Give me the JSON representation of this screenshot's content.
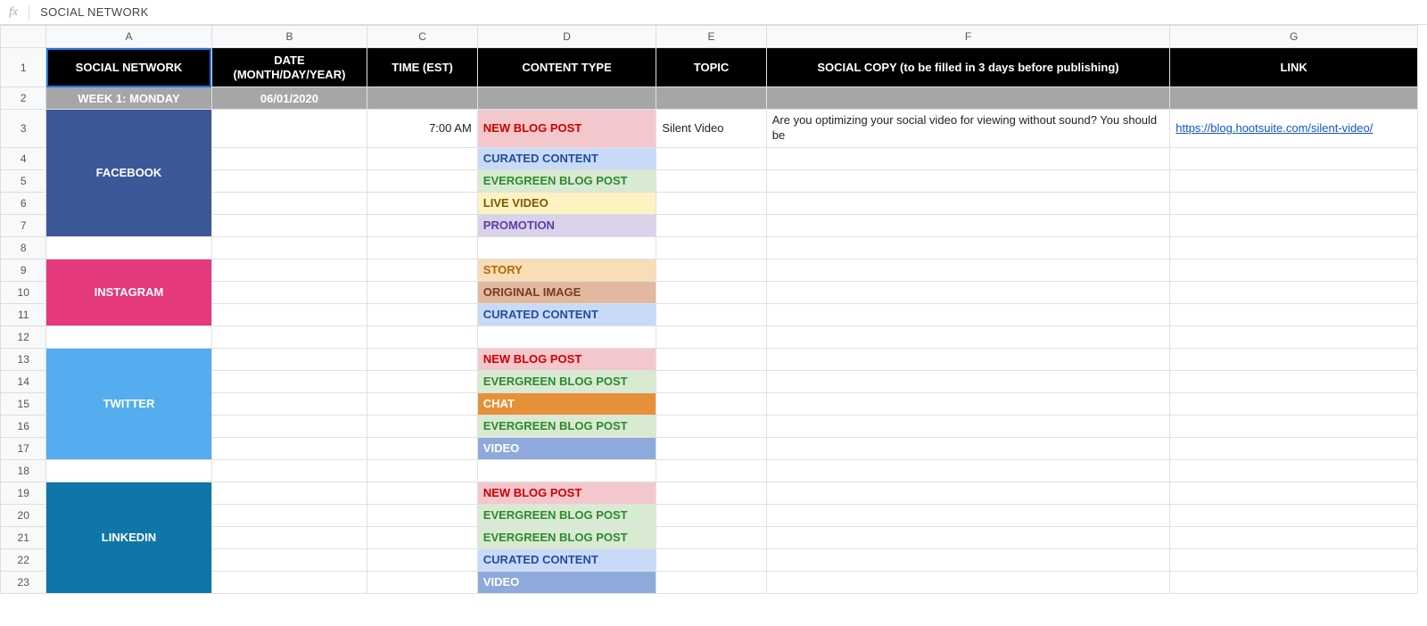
{
  "formula_bar": {
    "fx": "fx",
    "value": "SOCIAL NETWORK"
  },
  "columns": [
    "A",
    "B",
    "C",
    "D",
    "E",
    "F",
    "G"
  ],
  "headers": {
    "A": "SOCIAL NETWORK",
    "B": "DATE (MONTH/DAY/YEAR)",
    "C": "TIME (EST)",
    "D": "CONTENT TYPE",
    "E": "TOPIC",
    "F": "SOCIAL COPY (to be filled in 3 days before publishing)",
    "G": "LINK"
  },
  "week": {
    "label": "WEEK 1: MONDAY",
    "date": "06/01/2020"
  },
  "networks": {
    "facebook": "FACEBOOK",
    "instagram": "INSTAGRAM",
    "twitter": "TWITTER",
    "linkedin": "LINKEDIN"
  },
  "rows": {
    "3": {
      "time": "7:00 AM",
      "ct": "NEW BLOG POST",
      "ctClass": "ct-new-blog",
      "topic": "Silent Video",
      "copy": "Are you optimizing your social video for viewing without sound? You should be",
      "link": "https://blog.hootsuite.com/silent-video/"
    },
    "4": {
      "ct": "CURATED CONTENT",
      "ctClass": "ct-curated"
    },
    "5": {
      "ct": "EVERGREEN BLOG POST",
      "ctClass": "ct-evergreen"
    },
    "6": {
      "ct": "LIVE VIDEO",
      "ctClass": "ct-live-video"
    },
    "7": {
      "ct": "PROMOTION",
      "ctClass": "ct-promotion"
    },
    "9": {
      "ct": "STORY",
      "ctClass": "ct-story"
    },
    "10": {
      "ct": "ORIGINAL IMAGE",
      "ctClass": "ct-orig-image"
    },
    "11": {
      "ct": "CURATED CONTENT",
      "ctClass": "ct-curated"
    },
    "13": {
      "ct": "NEW BLOG POST",
      "ctClass": "ct-new-blog"
    },
    "14": {
      "ct": "EVERGREEN BLOG POST",
      "ctClass": "ct-evergreen"
    },
    "15": {
      "ct": "CHAT",
      "ctClass": "ct-chat"
    },
    "16": {
      "ct": "EVERGREEN BLOG POST",
      "ctClass": "ct-evergreen"
    },
    "17": {
      "ct": "VIDEO",
      "ctClass": "ct-video"
    },
    "19": {
      "ct": "NEW BLOG POST",
      "ctClass": "ct-new-blog"
    },
    "20": {
      "ct": "EVERGREEN BLOG POST",
      "ctClass": "ct-evergreen"
    },
    "21": {
      "ct": "EVERGREEN BLOG POST",
      "ctClass": "ct-evergreen"
    },
    "22": {
      "ct": "CURATED CONTENT",
      "ctClass": "ct-curated"
    },
    "23": {
      "ct": "VIDEO",
      "ctClass": "ct-video"
    }
  }
}
